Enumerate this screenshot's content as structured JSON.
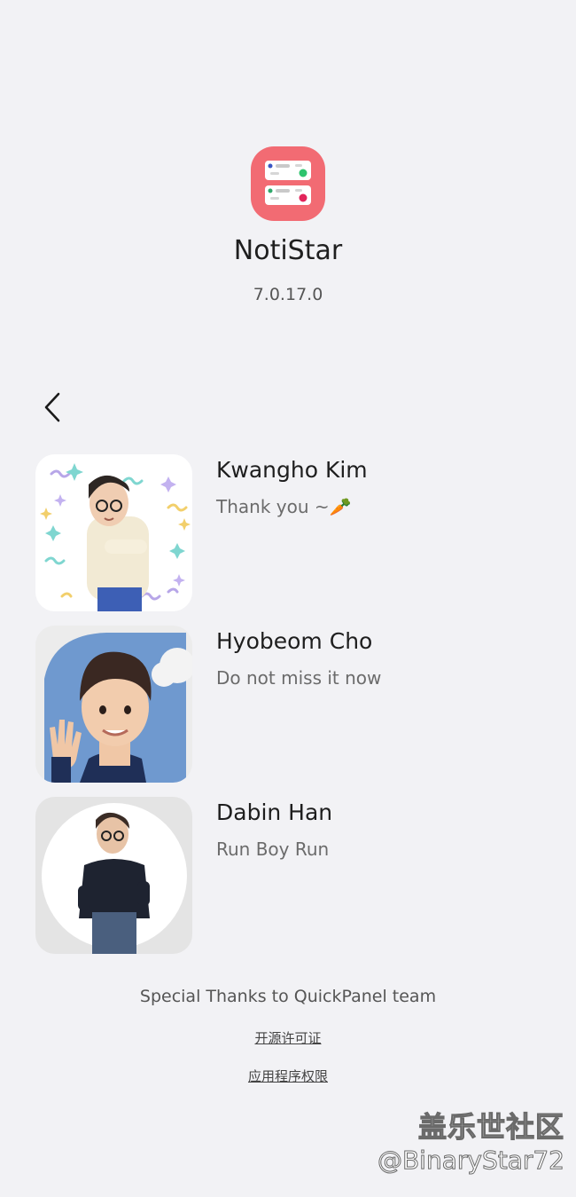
{
  "app": {
    "name": "NotiStar",
    "version": "7.0.17.0",
    "icon_name": "notistar-app-icon",
    "icon_color": "#f26b73"
  },
  "nav": {
    "back_icon": "chevron-left-icon"
  },
  "developers": [
    {
      "name": "Kwangho Kim",
      "message": "Thank you ~🥕",
      "avatar": "confetti-avatar"
    },
    {
      "name": "Hyobeom Cho",
      "message": "Do not miss it now",
      "avatar": "waving-avatar"
    },
    {
      "name": "Dabin Han",
      "message": "Run Boy Run",
      "avatar": "running-avatar"
    }
  ],
  "footer": {
    "thanks": "Special Thanks to QuickPanel team",
    "license_link": "开源许可证",
    "permissions_link": "应用程序权限"
  },
  "watermark": {
    "title": "盖乐世社区",
    "handle": "@BinaryStar72"
  }
}
